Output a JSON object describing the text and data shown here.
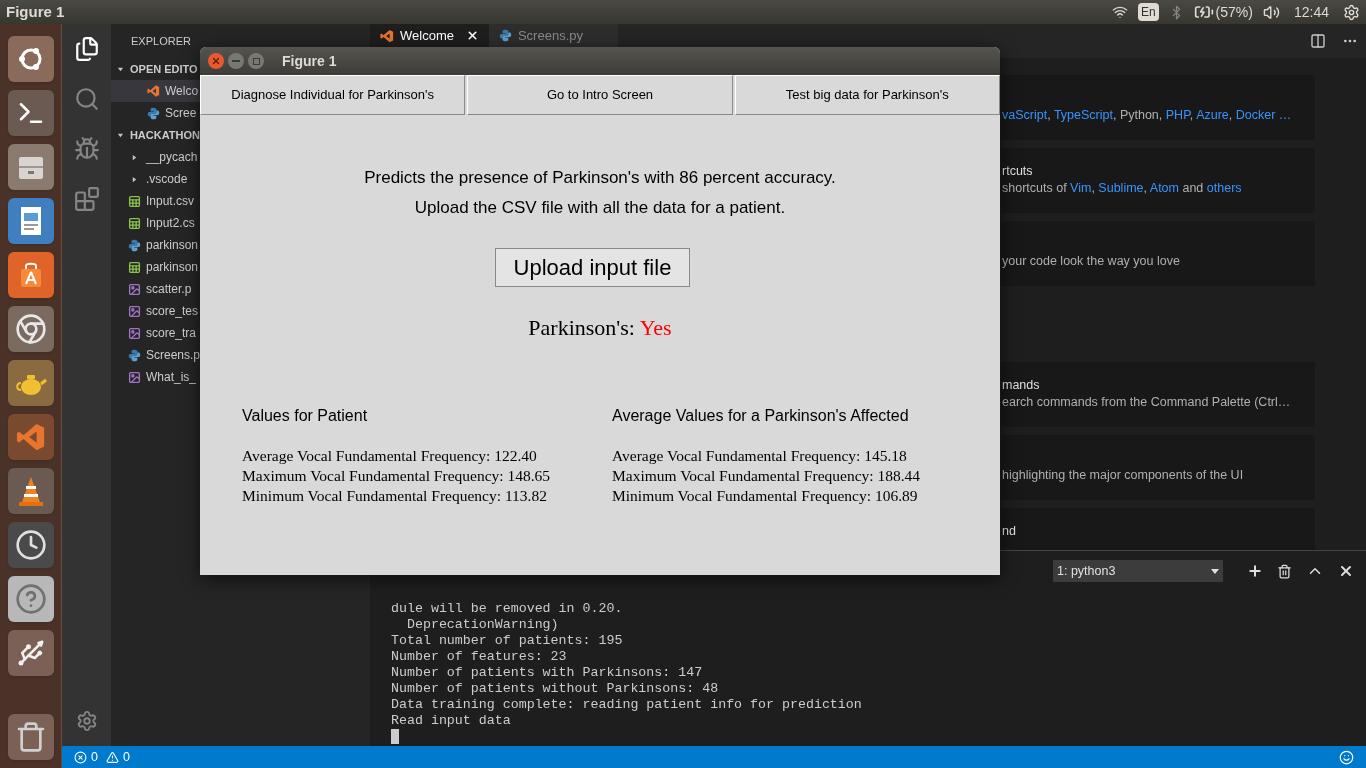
{
  "top_bar": {
    "app_title": "Figure 1",
    "keyboard": "En",
    "battery": "(57%)",
    "clock": "12:44"
  },
  "explorer": {
    "title": "EXPLORER",
    "sections": [
      {
        "label": "OPEN EDITO",
        "expanded": true,
        "items": [
          {
            "label": "Welco",
            "kind": "vscode",
            "selected": true
          },
          {
            "label": "Scree",
            "kind": "python",
            "selected": false
          }
        ]
      },
      {
        "label": "HACKATHON",
        "expanded": true,
        "items": [
          {
            "label": "__pycach",
            "kind": "folder",
            "selected": false
          },
          {
            "label": ".vscode",
            "kind": "folder",
            "selected": false
          },
          {
            "label": "Input.csv",
            "kind": "csv",
            "selected": false
          },
          {
            "label": "Input2.cs",
            "kind": "csv",
            "selected": false
          },
          {
            "label": "parkinson",
            "kind": "python",
            "selected": false
          },
          {
            "label": "parkinson",
            "kind": "csv",
            "selected": false
          },
          {
            "label": "scatter.p",
            "kind": "image",
            "selected": false
          },
          {
            "label": "score_tes",
            "kind": "image",
            "selected": false
          },
          {
            "label": "score_tra",
            "kind": "image",
            "selected": false
          },
          {
            "label": "Screens.p",
            "kind": "python",
            "selected": false
          },
          {
            "label": "What_is_",
            "kind": "image",
            "selected": false
          }
        ]
      }
    ]
  },
  "tabs": [
    {
      "label": "Welcome",
      "kind": "vscode",
      "selected": true
    },
    {
      "label": "Screens.py",
      "kind": "python",
      "selected": false
    }
  ],
  "welcome_cards": [
    {
      "description": [
        {
          "text": "vaScript",
          "link": true
        },
        {
          "text": ", "
        },
        {
          "text": "TypeScript",
          "link": true
        },
        {
          "text": ", Python, "
        },
        {
          "text": "PHP",
          "link": true
        },
        {
          "text": ", "
        },
        {
          "text": "Azure",
          "link": true
        },
        {
          "text": ", "
        },
        {
          "text": "Docker …",
          "link": true
        }
      ]
    },
    {
      "title": "rtcuts",
      "description": [
        {
          "text": "shortcuts of "
        },
        {
          "text": "Vim",
          "link": true
        },
        {
          "text": ", "
        },
        {
          "text": "Sublime",
          "link": true
        },
        {
          "text": ", "
        },
        {
          "text": "Atom",
          "link": true
        },
        {
          "text": " and "
        },
        {
          "text": "others",
          "link": true
        }
      ]
    },
    {
      "description": [
        {
          "text": "your code look the way you love"
        }
      ]
    },
    {
      "title": "mands",
      "description": [
        {
          "text": "earch commands from the Command Palette (Ctrl…"
        }
      ]
    },
    {
      "description": [
        {
          "text": "highlighting the major components of the UI"
        }
      ]
    },
    {
      "title": "nd"
    }
  ],
  "terminal": {
    "selector": "1: python3",
    "lines": [
      "dule will be removed in 0.20.",
      "  DeprecationWarning)",
      "Total number of patients: 195",
      "Number of features: 23",
      "Number of patients with Parkinsons: 147",
      "Number of patients without Parkinsons: 48",
      "Data training complete: reading patient info for prediction",
      "Read input data"
    ]
  },
  "status_bar": {
    "errors": "0",
    "warnings": "0"
  },
  "figure": {
    "title": "Figure 1",
    "buttons": [
      "Diagnose Individual for Parkinson's",
      "Go to Intro Screen",
      "Test big data for Parkinson's"
    ],
    "description": [
      "Predicts the presence of Parkinson's with 86 percent accuracy.",
      "Upload the CSV file with all the data for a patient."
    ],
    "upload_button": "Upload input file",
    "result_label": "Parkinson's:",
    "result_value": "Yes",
    "columns": [
      {
        "heading": "Values for Patient",
        "rows": [
          "Average Vocal Fundamental Frequency: 122.40",
          "Maximum Vocal Fundamental Frequency: 148.65",
          "Minimum Vocal Fundamental Frequency: 113.82"
        ]
      },
      {
        "heading": "Average Values for a Parkinson's Affected",
        "rows": [
          "Average Vocal Fundamental Frequency: 145.18",
          "Maximum Vocal Fundamental Frequency: 188.44",
          "Minimum Vocal Fundamental Frequency: 106.89"
        ]
      }
    ]
  }
}
